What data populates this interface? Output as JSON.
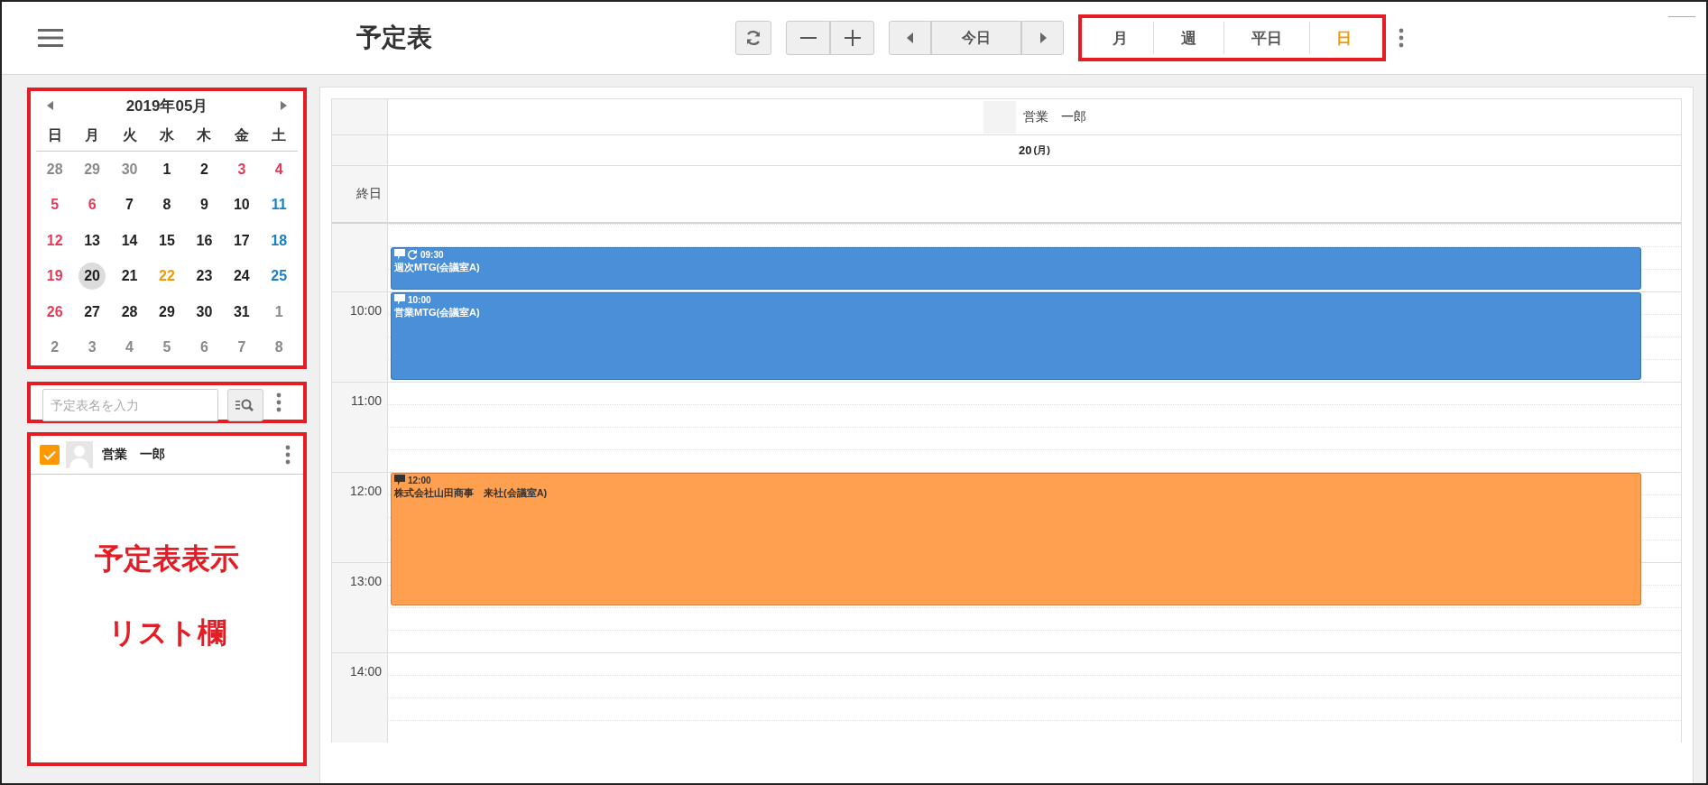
{
  "topbar": {
    "title": "予定表",
    "today_button": "今日",
    "view_tabs": [
      {
        "label": "月",
        "selected": false
      },
      {
        "label": "週",
        "selected": false
      },
      {
        "label": "平日",
        "selected": false
      },
      {
        "label": "日",
        "selected": true
      }
    ]
  },
  "mini_calendar": {
    "month": "2019年05月",
    "weekdays": [
      "日",
      "月",
      "火",
      "水",
      "木",
      "金",
      "土"
    ],
    "weeks": [
      [
        {
          "day": "28",
          "kind": "outside",
          "selected": false
        },
        {
          "day": "29",
          "kind": "outside",
          "selected": false
        },
        {
          "day": "30",
          "kind": "outside",
          "selected": false
        },
        {
          "day": "1",
          "kind": "weekday",
          "selected": false
        },
        {
          "day": "2",
          "kind": "weekday",
          "selected": false
        },
        {
          "day": "3",
          "kind": "holiday",
          "selected": false
        },
        {
          "day": "4",
          "kind": "holiday",
          "selected": false
        }
      ],
      [
        {
          "day": "5",
          "kind": "holiday",
          "selected": false
        },
        {
          "day": "6",
          "kind": "holiday",
          "selected": false
        },
        {
          "day": "7",
          "kind": "weekday",
          "selected": false
        },
        {
          "day": "8",
          "kind": "weekday",
          "selected": false
        },
        {
          "day": "9",
          "kind": "weekday",
          "selected": false
        },
        {
          "day": "10",
          "kind": "weekday",
          "selected": false
        },
        {
          "day": "11",
          "kind": "saturday",
          "selected": false
        }
      ],
      [
        {
          "day": "12",
          "kind": "holiday",
          "selected": false
        },
        {
          "day": "13",
          "kind": "weekday",
          "selected": false
        },
        {
          "day": "14",
          "kind": "weekday",
          "selected": false
        },
        {
          "day": "15",
          "kind": "weekday",
          "selected": false
        },
        {
          "day": "16",
          "kind": "weekday",
          "selected": false
        },
        {
          "day": "17",
          "kind": "weekday",
          "selected": false
        },
        {
          "day": "18",
          "kind": "saturday",
          "selected": false
        }
      ],
      [
        {
          "day": "19",
          "kind": "holiday",
          "selected": false
        },
        {
          "day": "20",
          "kind": "weekday",
          "selected": true
        },
        {
          "day": "21",
          "kind": "weekday",
          "selected": false
        },
        {
          "day": "22",
          "kind": "highlight",
          "selected": false
        },
        {
          "day": "23",
          "kind": "weekday",
          "selected": false
        },
        {
          "day": "24",
          "kind": "weekday",
          "selected": false
        },
        {
          "day": "25",
          "kind": "saturday",
          "selected": false
        }
      ],
      [
        {
          "day": "26",
          "kind": "holiday",
          "selected": false
        },
        {
          "day": "27",
          "kind": "weekday",
          "selected": false
        },
        {
          "day": "28",
          "kind": "weekday",
          "selected": false
        },
        {
          "day": "29",
          "kind": "weekday",
          "selected": false
        },
        {
          "day": "30",
          "kind": "weekday",
          "selected": false
        },
        {
          "day": "31",
          "kind": "weekday",
          "selected": false
        },
        {
          "day": "1",
          "kind": "outside",
          "selected": false
        }
      ],
      [
        {
          "day": "2",
          "kind": "outside",
          "selected": false
        },
        {
          "day": "3",
          "kind": "outside",
          "selected": false
        },
        {
          "day": "4",
          "kind": "outside",
          "selected": false
        },
        {
          "day": "5",
          "kind": "outside",
          "selected": false
        },
        {
          "day": "6",
          "kind": "outside",
          "selected": false
        },
        {
          "day": "7",
          "kind": "outside",
          "selected": false
        },
        {
          "day": "8",
          "kind": "outside",
          "selected": false
        }
      ]
    ]
  },
  "search": {
    "placeholder": "予定表名を入力"
  },
  "schedule_list": [
    {
      "name": "営業　一郎",
      "checked": true
    }
  ],
  "annotation_text": [
    "予定表表示",
    "リスト欄"
  ],
  "day_view": {
    "user": "営業　一郎",
    "date": "20",
    "weekday": "(月)",
    "all_day_label": "終日",
    "hours": [
      "10:00",
      "11:00",
      "12:00",
      "13:00",
      "14:00"
    ],
    "events": [
      {
        "time": "09:30",
        "title": "週次MTG(会議室A)",
        "comment": true,
        "repeat": true,
        "color": "#4a90d9"
      },
      {
        "time": "10:00",
        "title": "営業MTG(会議室A)",
        "comment": true,
        "repeat": false,
        "color": "#4a90d9"
      },
      {
        "time": "12:00",
        "title": "株式会社山田商事　来社(会議室A)",
        "comment": true,
        "repeat": false,
        "color": "#ff9f50"
      }
    ]
  }
}
